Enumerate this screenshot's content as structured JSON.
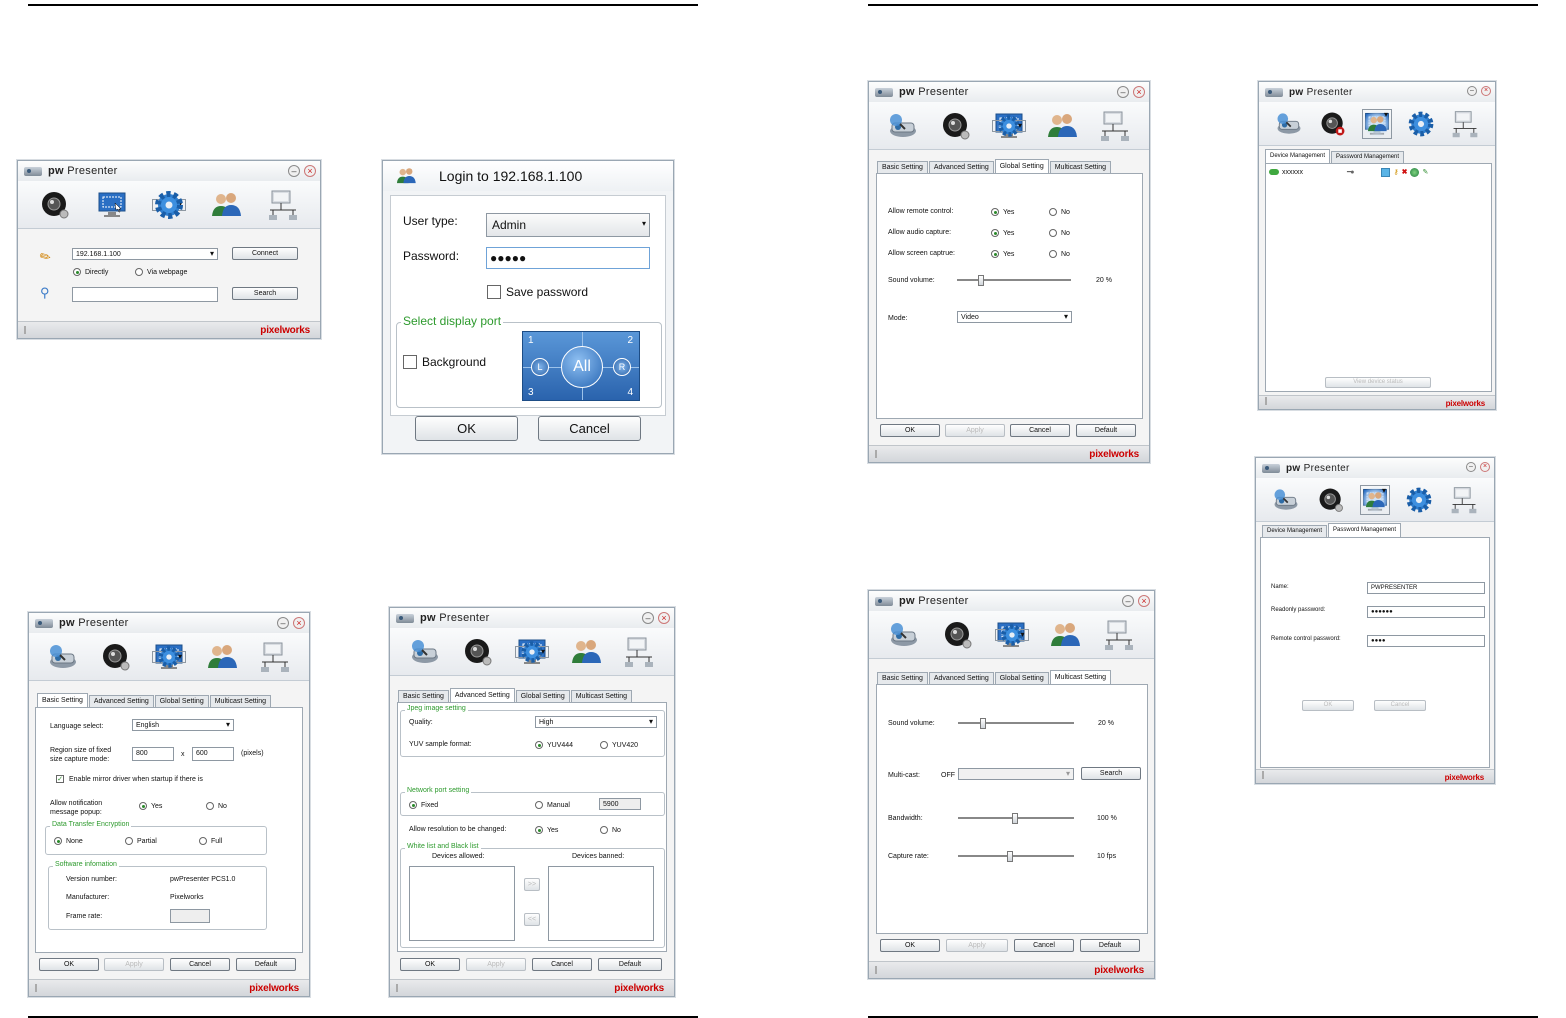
{
  "w1": {
    "title": "Presenter",
    "brand": "pw",
    "ip": "192.168.1.100",
    "connect": "Connect",
    "directly": "Directly",
    "via": "Via webpage",
    "search": "Search",
    "logo1": "pi",
    "logo2": "x",
    "logo3": "elworks"
  },
  "login": {
    "title": "Login to 192.168.1.100",
    "user_type_label": "User type:",
    "user_type": "Admin",
    "password_label": "Password:",
    "password": "●●●●●",
    "save_password": "Save password",
    "display_port": "Select display port",
    "background": "Background",
    "ports": {
      "n1": "1",
      "n2": "2",
      "n3": "3",
      "n4": "4",
      "all": "All",
      "l": "L",
      "r": "R"
    },
    "ok": "OK",
    "cancel": "Cancel"
  },
  "tabs": {
    "basic": "Basic Setting",
    "advanced": "Advanced Setting",
    "global": "Global Setting",
    "multicast": "Multicast Setting",
    "device": "Device Management",
    "password": "Password Management"
  },
  "buttons": {
    "ok": "OK",
    "apply": "Apply",
    "cancel": "Cancel",
    "default": "Default",
    "search": "Search",
    "view": "View device status"
  },
  "glob": {
    "remote": "Allow remote control:",
    "audio": "Allow audio capture:",
    "screen": "Allow screen captrue:",
    "yes": "Yes",
    "no": "No",
    "volume": "Sound volume:",
    "volume_val": "20 %",
    "mode": "Mode:",
    "mode_val": "Video"
  },
  "dev": {
    "name": "xxxxxx"
  },
  "pwd": {
    "name_label": "Name:",
    "name": "PWPRESENTER",
    "ro_label": "Readonly password:",
    "ro": "●●●●●●",
    "rc_label": "Remote control password:",
    "rc": "●●●●",
    "ok": "OK",
    "cancel": "Cancel"
  },
  "basic": {
    "lang_label": "Language select:",
    "lang": "English",
    "region_label1": "Region size of fixed",
    "region_label2": "size capture mode:",
    "w": "800",
    "x": "x",
    "h": "600",
    "pixels": "(pixels)",
    "mirror": "Enable mirror driver when startup if there is",
    "notif1": "Allow notification",
    "notif2": "message popup:",
    "yes": "Yes",
    "no": "No",
    "enc": "Data Transfer Encryption",
    "none": "None",
    "partial": "Partial",
    "full": "Full",
    "sw": "Software infomation",
    "ver_label": "Version number:",
    "ver": "pwPresenter PCS1.0",
    "man_label": "Manufacturer:",
    "man": "Pixelworks",
    "fr_label": "Frame rate:"
  },
  "adv": {
    "jpeg": "Jpeg image setting",
    "quality_label": "Quality:",
    "quality": "High",
    "yuv_label": "YUV sample format:",
    "yuv444": "YUV444",
    "yuv420": "YUV420",
    "net": "Network port setting",
    "fixed": "Fixed",
    "manual": "Manual",
    "port": "5900",
    "res_label": "Allow resolution to be changed:",
    "yes": "Yes",
    "no": "No",
    "wl": "White list and Black list",
    "allowed": "Devices allowed:",
    "banned": "Devices banned:",
    "arr_r": ">>",
    "arr_l": "<<"
  },
  "mc": {
    "volume_label": "Sound volume:",
    "volume": "20 %",
    "mcast_label": "Multi-cast:",
    "mcast": "OFF",
    "bw_label": "Bandwidth:",
    "bw": "100 %",
    "cr_label": "Capture rate:",
    "cr": "10 fps"
  },
  "slider_levels": {
    "glob_volume": 0.2,
    "mc_volume": 0.2,
    "mc_bandwidth": 0.5,
    "mc_capture": 0.45
  }
}
